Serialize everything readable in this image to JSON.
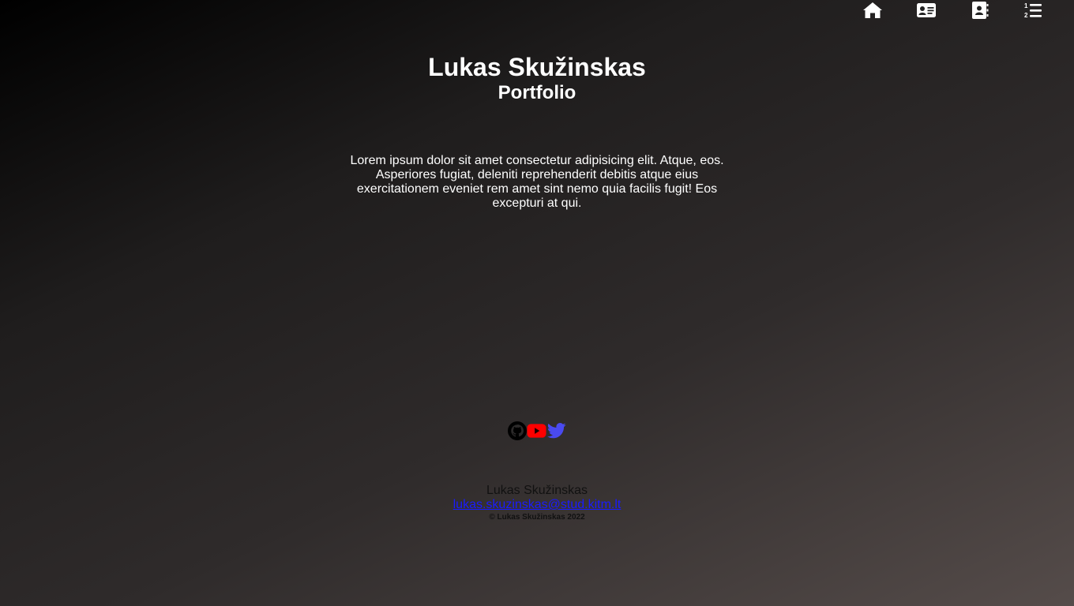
{
  "nav": {
    "items": [
      {
        "icon": "home-icon"
      },
      {
        "icon": "id-card-icon"
      },
      {
        "icon": "address-book-icon"
      },
      {
        "icon": "list-ol-icon"
      }
    ]
  },
  "header": {
    "title": "Lukas Skužinskas",
    "subtitle": "Portfolio"
  },
  "intro": {
    "text": "Lorem ipsum dolor sit amet consectetur adipisicing elit. Atque, eos. Asperiores fugiat, deleniti reprehenderit debitis atque eius exercitationem eveniet rem amet sint nemo quia facilis fugit! Eos excepturi at qui."
  },
  "socials": [
    {
      "icon": "github-icon",
      "color": "#000000"
    },
    {
      "icon": "youtube-icon",
      "color": "#ff0000"
    },
    {
      "icon": "twitter-icon",
      "color": "#4a4af0"
    }
  ],
  "footer": {
    "name": "Lukas Skužinskas",
    "email": "lukas.skuzinskas@stud.kitm.lt",
    "copyright": "© Lukas Skužinskas 2022"
  },
  "colors": {
    "text": "#ffffff",
    "footer_text": "#111111",
    "link": "#1a1aff"
  }
}
